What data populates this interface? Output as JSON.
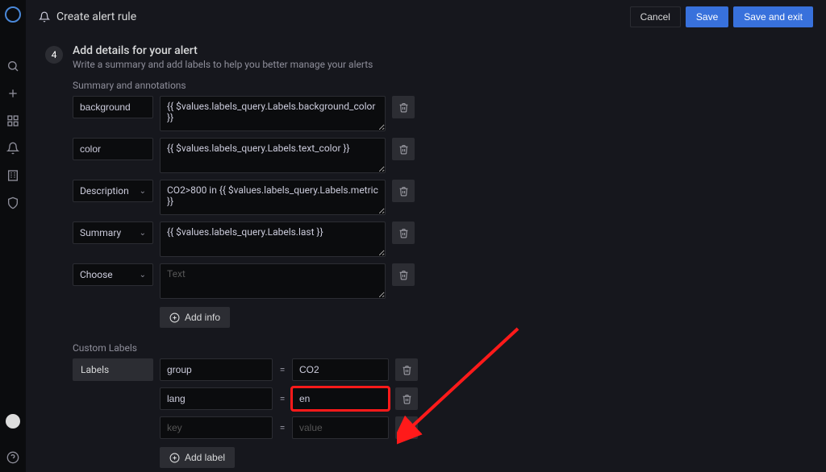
{
  "header": {
    "title": "Create alert rule",
    "cancel": "Cancel",
    "save": "Save",
    "save_exit": "Save and exit"
  },
  "step": {
    "number": "4",
    "title": "Add details for your alert",
    "subtitle": "Write a summary and add labels to help you better manage your alerts"
  },
  "annotations": {
    "section_label": "Summary and annotations",
    "items": [
      {
        "key_type": "text",
        "key": "background",
        "value": "{{ $values.labels_query.Labels.background_color }}"
      },
      {
        "key_type": "text",
        "key": "color",
        "value": "{{ $values.labels_query.Labels.text_color }}"
      },
      {
        "key_type": "select",
        "key": "Description",
        "value": "CO2>800 in {{ $values.labels_query.Labels.metric }}"
      },
      {
        "key_type": "select",
        "key": "Summary",
        "value": "{{ $values.labels_query.Labels.last }}"
      },
      {
        "key_type": "select",
        "key": "Choose",
        "value": "",
        "placeholder": "Text"
      }
    ],
    "add_button": "Add info"
  },
  "labels": {
    "section_label": "Custom Labels",
    "tag": "Labels",
    "items": [
      {
        "key": "group",
        "value": "CO2",
        "highlight": false
      },
      {
        "key": "lang",
        "value": "en",
        "highlight": true
      },
      {
        "key": "",
        "value": "",
        "key_placeholder": "key",
        "value_placeholder": "value",
        "highlight": false
      }
    ],
    "add_button": "Add label"
  }
}
